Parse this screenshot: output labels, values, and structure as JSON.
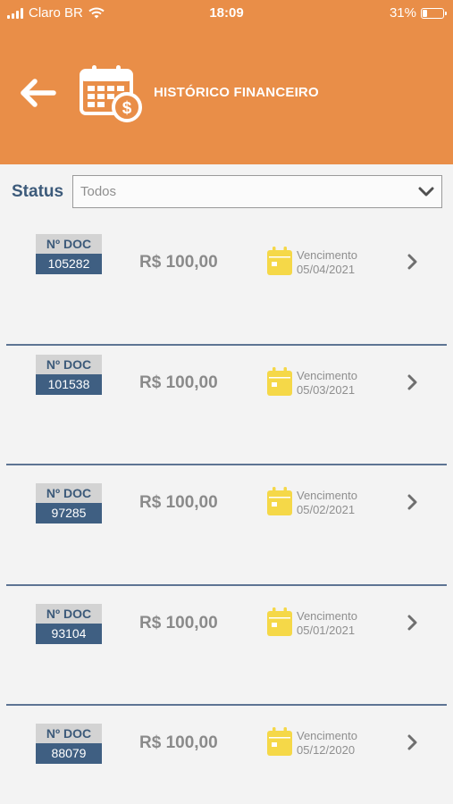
{
  "status_bar": {
    "carrier": "Claro BR",
    "time": "18:09",
    "battery": "31%",
    "battery_level": 0.31
  },
  "header": {
    "title": "HISTÓRICO FINANCEIRO",
    "icon": "calendar-dollar-icon",
    "back_icon": "arrow-left-icon"
  },
  "filter": {
    "label": "Status",
    "selected": "Todos"
  },
  "colors": {
    "header": "#e98e48",
    "doc_badge": "#3f5f82",
    "calendar": "#f5d848",
    "divider": "#5d7493"
  },
  "items": [
    {
      "doc_label": "Nº DOC",
      "doc_number": "105282",
      "amount": "R$ 100,00",
      "due_label": "Vencimento",
      "due_date": "05/04/2021"
    },
    {
      "doc_label": "Nº DOC",
      "doc_number": "101538",
      "amount": "R$ 100,00",
      "due_label": "Vencimento",
      "due_date": "05/03/2021"
    },
    {
      "doc_label": "Nº DOC",
      "doc_number": "97285",
      "amount": "R$ 100,00",
      "due_label": "Vencimento",
      "due_date": "05/02/2021"
    },
    {
      "doc_label": "Nº DOC",
      "doc_number": "93104",
      "amount": "R$ 100,00",
      "due_label": "Vencimento",
      "due_date": "05/01/2021"
    },
    {
      "doc_label": "Nº DOC",
      "doc_number": "88079",
      "amount": "R$ 100,00",
      "due_label": "Vencimento",
      "due_date": "05/12/2020"
    }
  ]
}
